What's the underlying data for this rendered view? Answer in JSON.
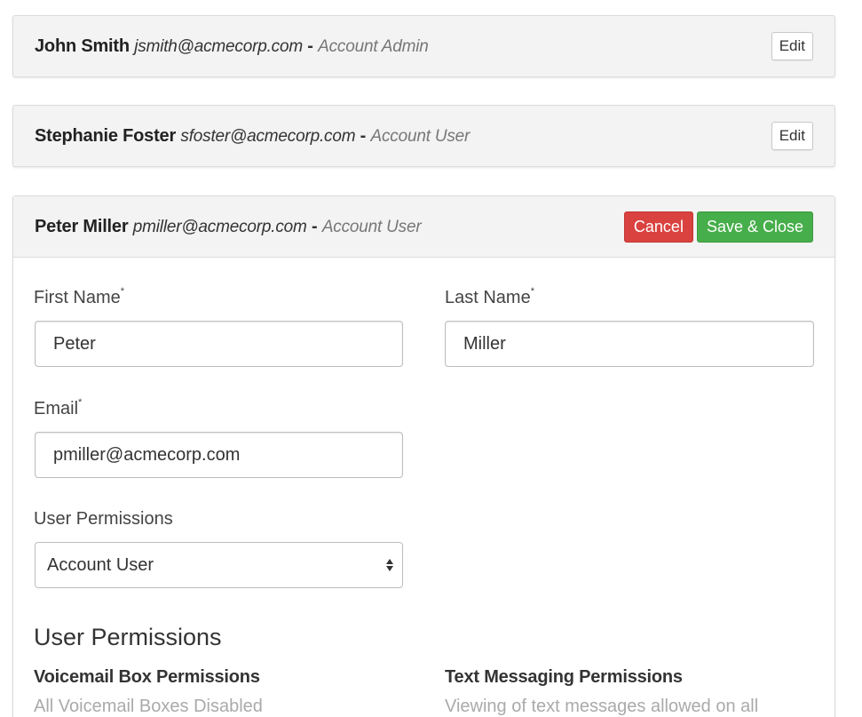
{
  "users": [
    {
      "name": "John Smith",
      "email": "jsmith@acmecorp.com",
      "separator": " - ",
      "role": "Account Admin",
      "edit_label": "Edit"
    },
    {
      "name": "Stephanie Foster",
      "email": "sfoster@acmecorp.com",
      "separator": " - ",
      "role": "Account User",
      "edit_label": "Edit"
    }
  ],
  "editing": {
    "name": "Peter Miller",
    "email": "pmiller@acmecorp.com",
    "separator": " - ",
    "role": "Account User",
    "cancel_label": "Cancel",
    "save_label": "Save & Close",
    "form": {
      "first_name_label": "First Name",
      "first_name_value": "Peter",
      "last_name_label": "Last Name",
      "last_name_value": "Miller",
      "email_label": "Email",
      "email_value": "pmiller@acmecorp.com",
      "required_mark": "*",
      "permissions_label": "User Permissions",
      "permissions_selected": "Account User"
    },
    "permissions_section": {
      "heading": "User Permissions",
      "voicemail_title": "Voicemail Box Permissions",
      "voicemail_desc": "All Voicemail Boxes Disabled",
      "text_title": "Text Messaging Permissions",
      "text_desc": "Viewing of text messages allowed on all"
    }
  },
  "colors": {
    "cancel": "#d9423f",
    "save": "#46ae4a",
    "card_bg": "#f3f3f3"
  }
}
